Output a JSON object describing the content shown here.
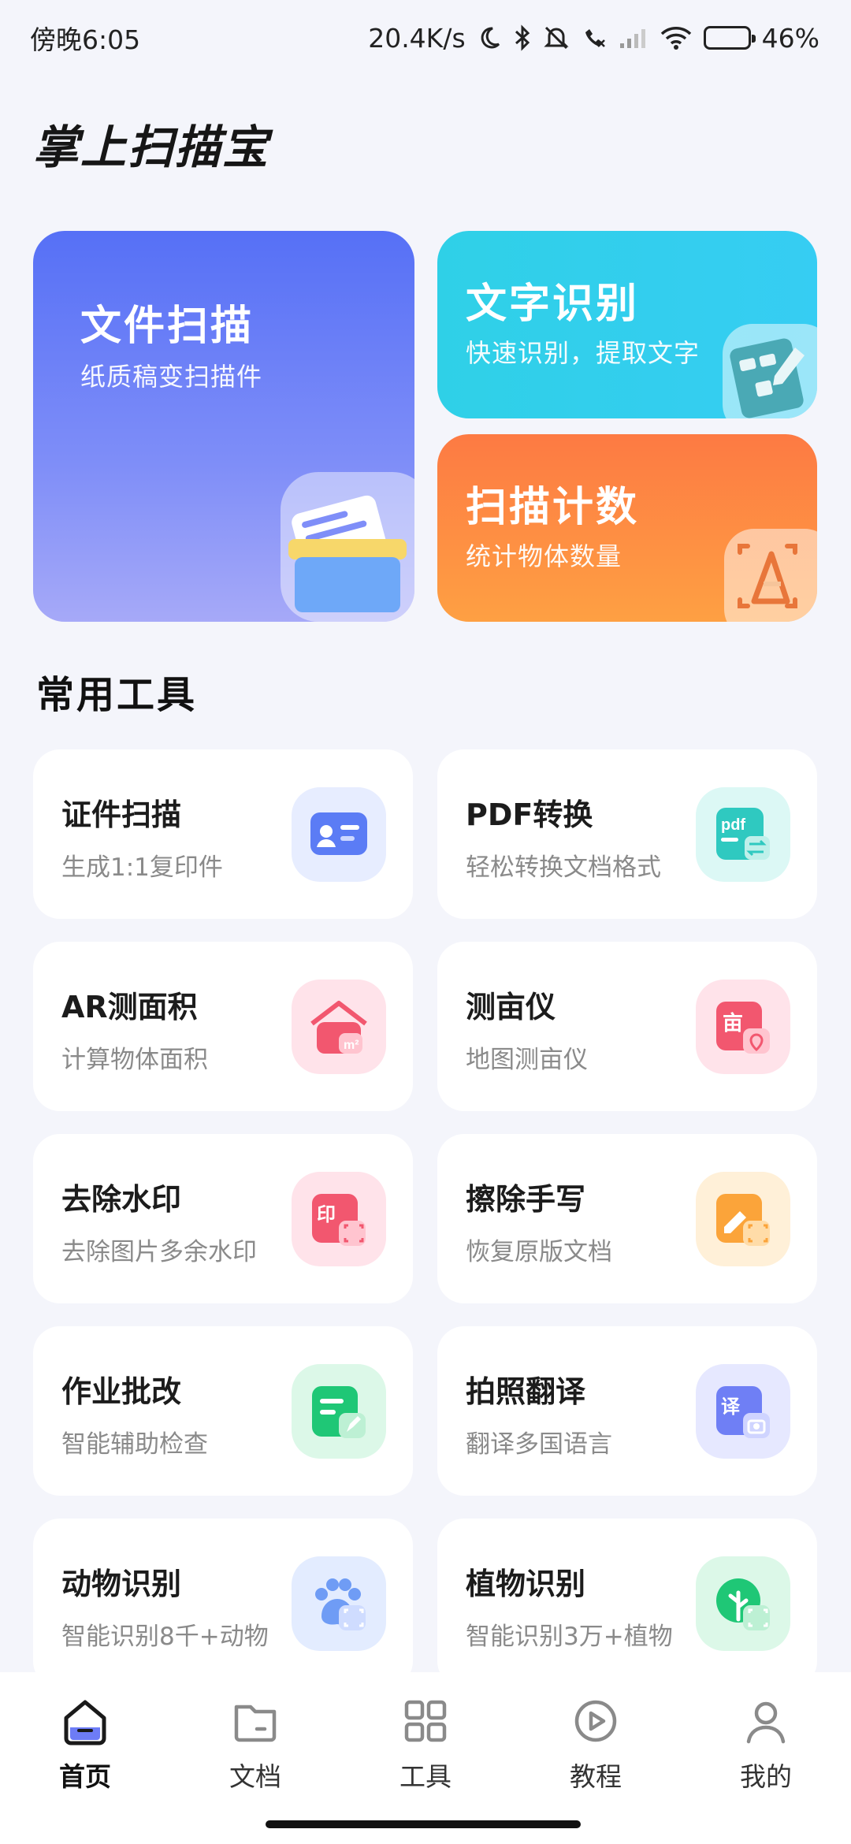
{
  "status_bar": {
    "time": "傍晚6:05",
    "net_speed": "20.4K/s",
    "battery": "46%",
    "battery_level": 0.46
  },
  "app": {
    "title": "掌上扫描宝"
  },
  "hero_cards": [
    {
      "title": "文件扫描",
      "subtitle": "纸质稿变扫描件",
      "icon": "scanner-icon",
      "color": "#5670f6"
    },
    {
      "title": "文字识别",
      "subtitle": "快速识别，提取文字",
      "icon": "text-recognition-icon",
      "color": "#2fd0e7"
    },
    {
      "title": "扫描计数",
      "subtitle": "统计物体数量",
      "icon": "count-icon",
      "color": "#fd7a43"
    }
  ],
  "section": {
    "title": "常用工具"
  },
  "tools": [
    {
      "title": "证件扫描",
      "subtitle": "生成1:1复印件",
      "icon": "id-card-icon",
      "color": "#5b7cf5"
    },
    {
      "title": "PDF转换",
      "subtitle": "轻松转换文档格式",
      "icon": "pdf-icon",
      "color": "#2fc9c0"
    },
    {
      "title": "AR测面积",
      "subtitle": "计算物体面积",
      "icon": "area-icon",
      "color": "#f2576f"
    },
    {
      "title": "测亩仪",
      "subtitle": "地图测亩仪",
      "icon": "mu-map-icon",
      "color": "#f2576f"
    },
    {
      "title": "去除水印",
      "subtitle": "去除图片多余水印",
      "icon": "watermark-icon",
      "color": "#f2576f"
    },
    {
      "title": "擦除手写",
      "subtitle": "恢复原版文档",
      "icon": "erase-handwriting-icon",
      "color": "#fba43a"
    },
    {
      "title": "作业批改",
      "subtitle": "智能辅助检查",
      "icon": "homework-icon",
      "color": "#1fc776"
    },
    {
      "title": "拍照翻译",
      "subtitle": "翻译多国语言",
      "icon": "translate-icon",
      "color": "#6f7ff5"
    },
    {
      "title": "动物识别",
      "subtitle": "智能识别8千+动物",
      "icon": "paw-icon",
      "color": "#6f9cf5"
    },
    {
      "title": "植物识别",
      "subtitle": "智能识别3万+植物",
      "icon": "plant-icon",
      "color": "#1fc776"
    }
  ],
  "tool_card_icons": {
    "icon_text": {
      "id": "",
      "pdf": "pdf",
      "area": "m²",
      "mu": "亩",
      "watermark": "印",
      "translate": "译"
    }
  },
  "nav": [
    {
      "label": "首页",
      "icon": "home-icon",
      "active": true
    },
    {
      "label": "文档",
      "icon": "folder-icon",
      "active": false
    },
    {
      "label": "工具",
      "icon": "grid-icon",
      "active": false
    },
    {
      "label": "教程",
      "icon": "play-icon",
      "active": false
    },
    {
      "label": "我的",
      "icon": "user-icon",
      "active": false
    }
  ]
}
